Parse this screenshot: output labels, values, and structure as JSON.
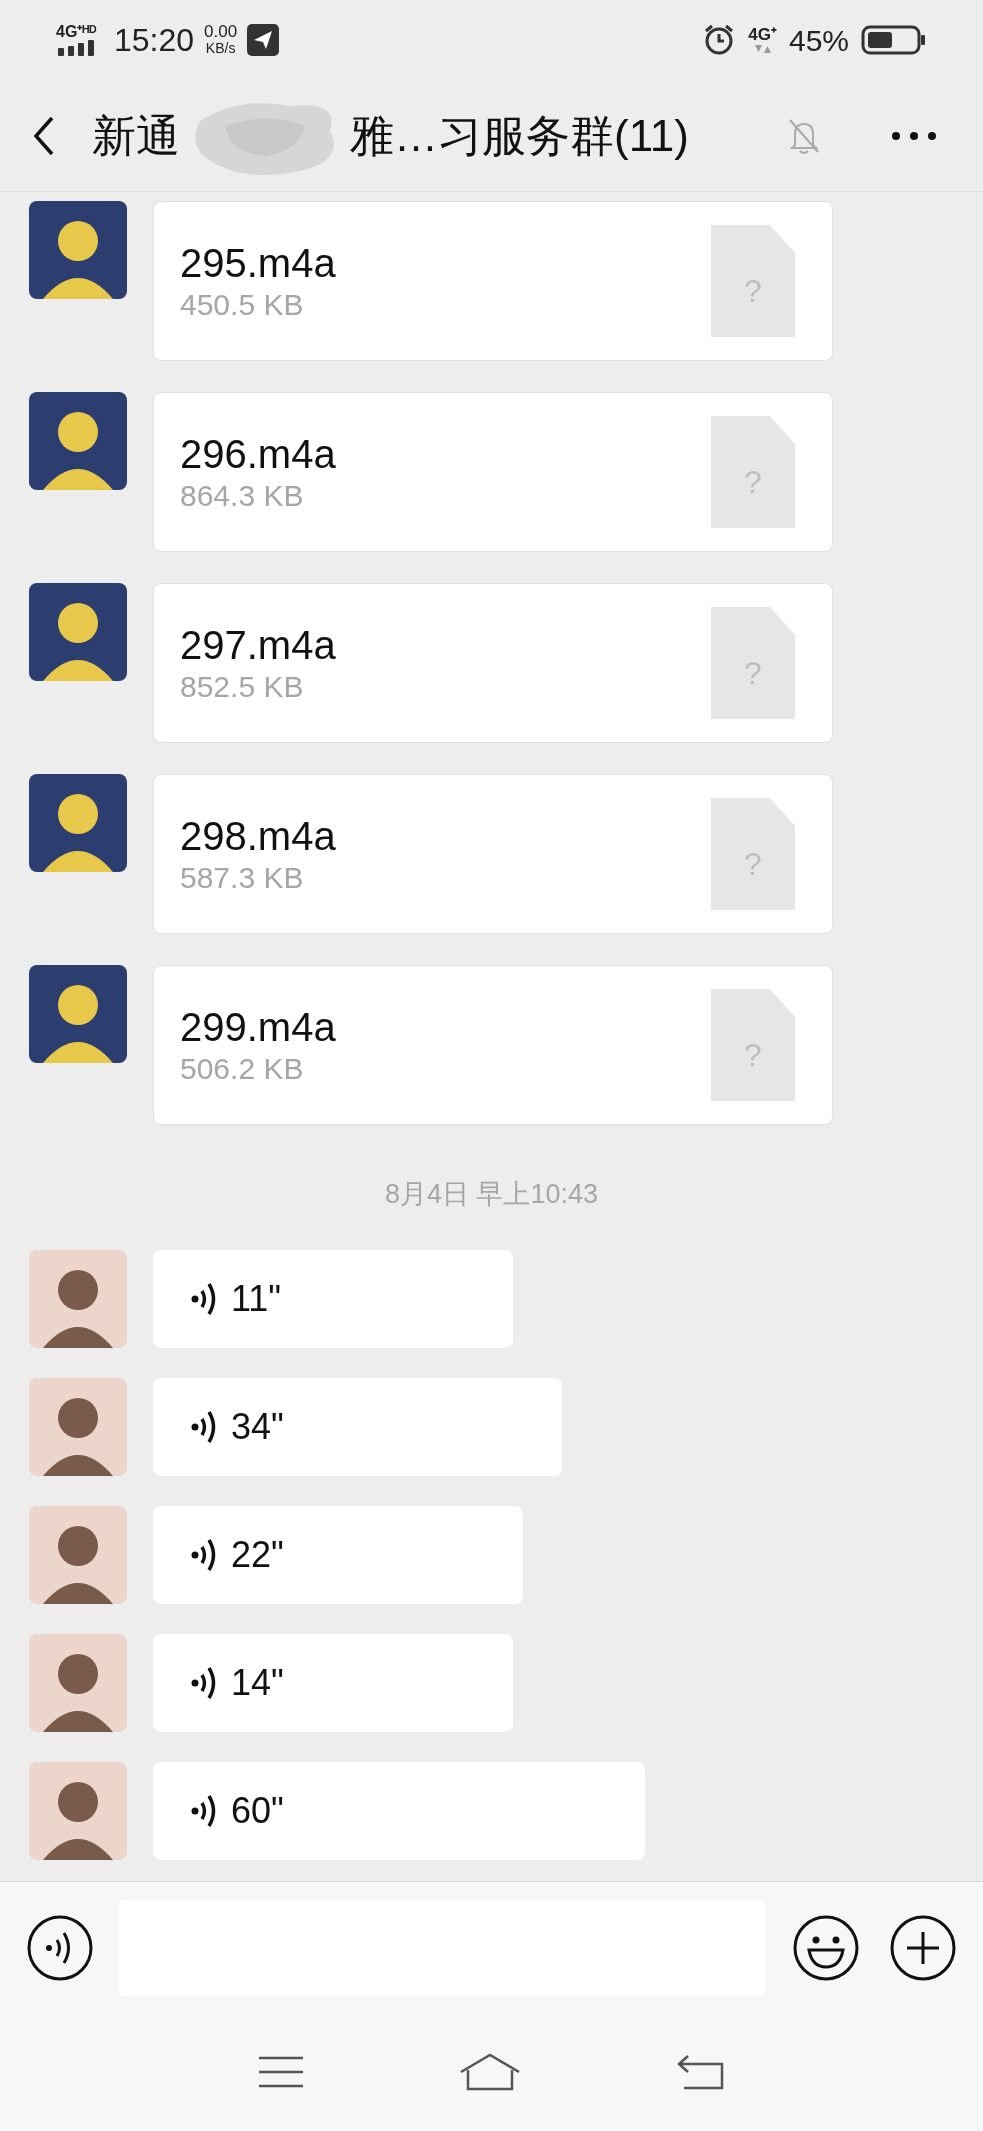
{
  "status_bar": {
    "network": "4G⁺ᴴᴰ",
    "time": "15:20",
    "speed_value": "0.00",
    "speed_unit": "KB/s",
    "mobile_data": "4G⁺",
    "battery": "45%"
  },
  "header": {
    "title_start": "新通",
    "title_end": "雅…习服务群(11)",
    "muted": true
  },
  "messages": [
    {
      "kind": "file",
      "name": "295.m4a",
      "size": "450.5 KB",
      "icon_glyph": "?"
    },
    {
      "kind": "file",
      "name": "296.m4a",
      "size": "864.3 KB",
      "icon_glyph": "?"
    },
    {
      "kind": "file",
      "name": "297.m4a",
      "size": "852.5 KB",
      "icon_glyph": "?"
    },
    {
      "kind": "file",
      "name": "298.m4a",
      "size": "587.3 KB",
      "icon_glyph": "?"
    },
    {
      "kind": "file",
      "name": "299.m4a",
      "size": "506.2 KB",
      "icon_glyph": "?"
    },
    {
      "kind": "time",
      "text": "8月4日 早上10:43"
    },
    {
      "kind": "voice",
      "duration": "11\""
    },
    {
      "kind": "voice",
      "duration": "34\""
    },
    {
      "kind": "voice",
      "duration": "22\""
    },
    {
      "kind": "voice",
      "duration": "14\""
    },
    {
      "kind": "voice",
      "duration": "60\""
    }
  ]
}
